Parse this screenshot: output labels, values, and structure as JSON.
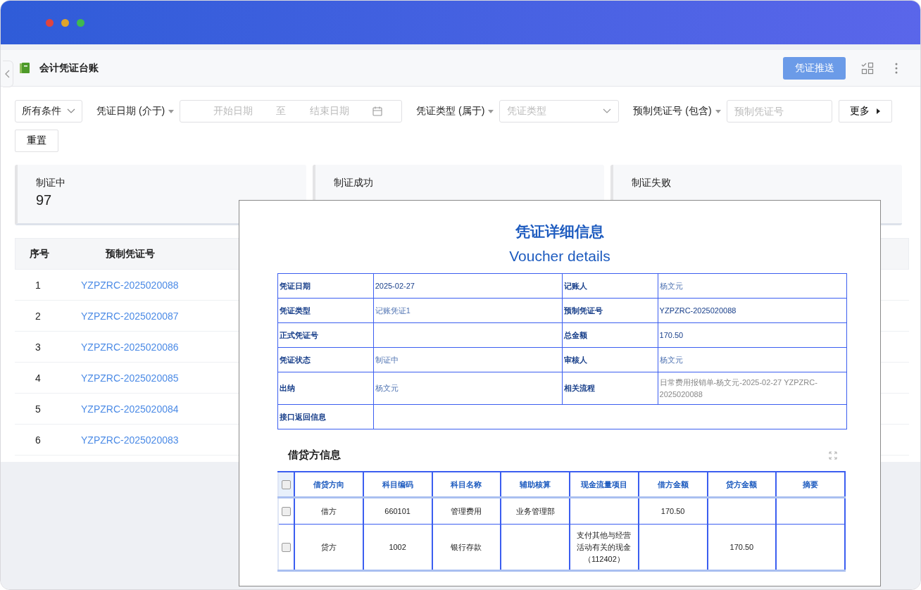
{
  "header": {
    "title": "会计凭证台账",
    "push_button": "凭证推送"
  },
  "filters": {
    "all_conditions": "所有条件",
    "date": {
      "label": "凭证日期 (介于)",
      "start_placeholder": "开始日期",
      "separator": "至",
      "end_placeholder": "结束日期"
    },
    "type": {
      "label": "凭证类型 (属于)",
      "placeholder": "凭证类型"
    },
    "pre_no": {
      "label": "预制凭证号 (包含)",
      "placeholder": "预制凭证号"
    },
    "more": "更多",
    "reset": "重置"
  },
  "stats": [
    {
      "label": "制证中",
      "value": "97"
    },
    {
      "label": "制证成功"
    },
    {
      "label": "制证失败"
    }
  ],
  "table": {
    "columns": [
      "序号",
      "预制凭证号"
    ],
    "rows": [
      {
        "index": "1",
        "number": "YZPZRC-2025020088"
      },
      {
        "index": "2",
        "number": "YZPZRC-2025020087"
      },
      {
        "index": "3",
        "number": "YZPZRC-2025020086"
      },
      {
        "index": "4",
        "number": "YZPZRC-2025020085"
      },
      {
        "index": "5",
        "number": "YZPZRC-2025020084"
      },
      {
        "index": "6",
        "number": "YZPZRC-2025020083"
      }
    ]
  },
  "dialog": {
    "title": "凭证详细信息",
    "subtitle": "Voucher details",
    "info_rows": [
      [
        {
          "label": "凭证日期",
          "value": "2025-02-27",
          "kind": "plain"
        },
        {
          "label": "记账人",
          "value": "杨文元",
          "kind": "ref"
        }
      ],
      [
        {
          "label": "凭证类型",
          "value": "记账凭证1",
          "kind": "ref"
        },
        {
          "label": "预制凭证号",
          "value": "YZPZRC-2025020088",
          "kind": "plain"
        }
      ],
      [
        {
          "label": "正式凭证号",
          "kind": "plain"
        },
        {
          "label": "总金额",
          "value": "170.50",
          "kind": "plain"
        }
      ],
      [
        {
          "label": "凭证状态",
          "value": "制证中",
          "kind": "ref"
        },
        {
          "label": "审核人",
          "value": "杨文元",
          "kind": "ref"
        }
      ],
      [
        {
          "label": "出纳",
          "value": "杨文元",
          "kind": "ref"
        },
        {
          "label": "相关流程",
          "value": "日常费用报销单-杨文元-2025-02-27 YZPZRC-2025020088",
          "kind": "muted"
        }
      ],
      [
        {
          "label": "接口返回信息",
          "kind": "plain"
        }
      ]
    ],
    "entries": {
      "title": "借贷方信息",
      "all_checked": false,
      "columns": [
        "借贷方向",
        "科目编码",
        "科目名称",
        "辅助核算",
        "现金流量项目",
        "借方金额",
        "贷方金额",
        "摘要"
      ],
      "rows": [
        {
          "checked": false,
          "direction": "借方",
          "account_code": "660101",
          "account_name": "管理费用",
          "auxiliary": "业务管理部",
          "debit_amount": "170.50"
        },
        {
          "checked": false,
          "direction": "贷方",
          "account_code": "1002",
          "account_name": "银行存款",
          "cash_flow_item": "支付其他与经营活动有关的现金（112402）",
          "credit_amount": "170.50"
        }
      ]
    }
  }
}
